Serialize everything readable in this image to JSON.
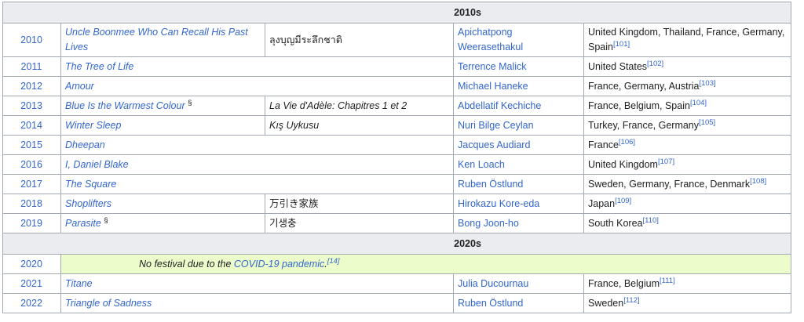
{
  "decades": [
    "2010s",
    "2020s"
  ],
  "rows": [
    {
      "year": "2010",
      "film": "Uncle Boonmee Who Can Recall His Past Lives",
      "film_mark": "",
      "original": "ลุงบุญมีระลึกชาติ",
      "director": "Apichatpong Weerasethakul",
      "country": "United Kingdom, Thailand, France, Germany, Spain",
      "ref": "[101]"
    },
    {
      "year": "2011",
      "film": "The Tree of Life",
      "film_mark": "",
      "original": "",
      "director": "Terrence Malick",
      "country": "United States",
      "ref": "[102]"
    },
    {
      "year": "2012",
      "film": "Amour",
      "film_mark": "",
      "original": "",
      "director": "Michael Haneke",
      "country": "France, Germany, Austria",
      "ref": "[103]"
    },
    {
      "year": "2013",
      "film": "Blue Is the Warmest Colour",
      "film_mark": "§",
      "original": "La Vie d'Adèle: Chapitres 1 et 2",
      "director": "Abdellatif Kechiche",
      "country": "France, Belgium, Spain",
      "ref": "[104]"
    },
    {
      "year": "2014",
      "film": "Winter Sleep",
      "film_mark": "",
      "original": "Kış Uykusu",
      "director": "Nuri Bilge Ceylan",
      "country": "Turkey, France, Germany",
      "ref": "[105]"
    },
    {
      "year": "2015",
      "film": "Dheepan",
      "film_mark": "",
      "original": "",
      "director": "Jacques Audiard",
      "country": "France",
      "ref": "[106]"
    },
    {
      "year": "2016",
      "film": "I, Daniel Blake",
      "film_mark": "",
      "original": "",
      "director": "Ken Loach",
      "country": "United Kingdom",
      "ref": "[107]"
    },
    {
      "year": "2017",
      "film": "The Square",
      "film_mark": "",
      "original": "",
      "director": "Ruben Östlund",
      "country": "Sweden, Germany, France, Denmark",
      "ref": "[108]"
    },
    {
      "year": "2018",
      "film": "Shoplifters",
      "film_mark": "",
      "original": "万引き家族",
      "director": "Hirokazu Kore-eda",
      "country": "Japan",
      "ref": "[109]"
    },
    {
      "year": "2019",
      "film": "Parasite",
      "film_mark": "§",
      "original": "기생충",
      "director": "Bong Joon-ho",
      "country": "South Korea",
      "ref": "[110]"
    }
  ],
  "nofest": {
    "year": "2020",
    "text_before": "No festival due to the ",
    "link": "COVID-19 pandemic",
    "text_after": ".",
    "ref": "[14]"
  },
  "rows_2020s": [
    {
      "year": "2021",
      "film": "Titane",
      "film_mark": "",
      "original": "",
      "director": "Julia Ducournau",
      "country": "France, Belgium",
      "ref": "[111]"
    },
    {
      "year": "2022",
      "film": "Triangle of Sadness",
      "film_mark": "",
      "original": "",
      "director": "Ruben Östlund",
      "country": "Sweden",
      "ref": "[112]"
    }
  ]
}
